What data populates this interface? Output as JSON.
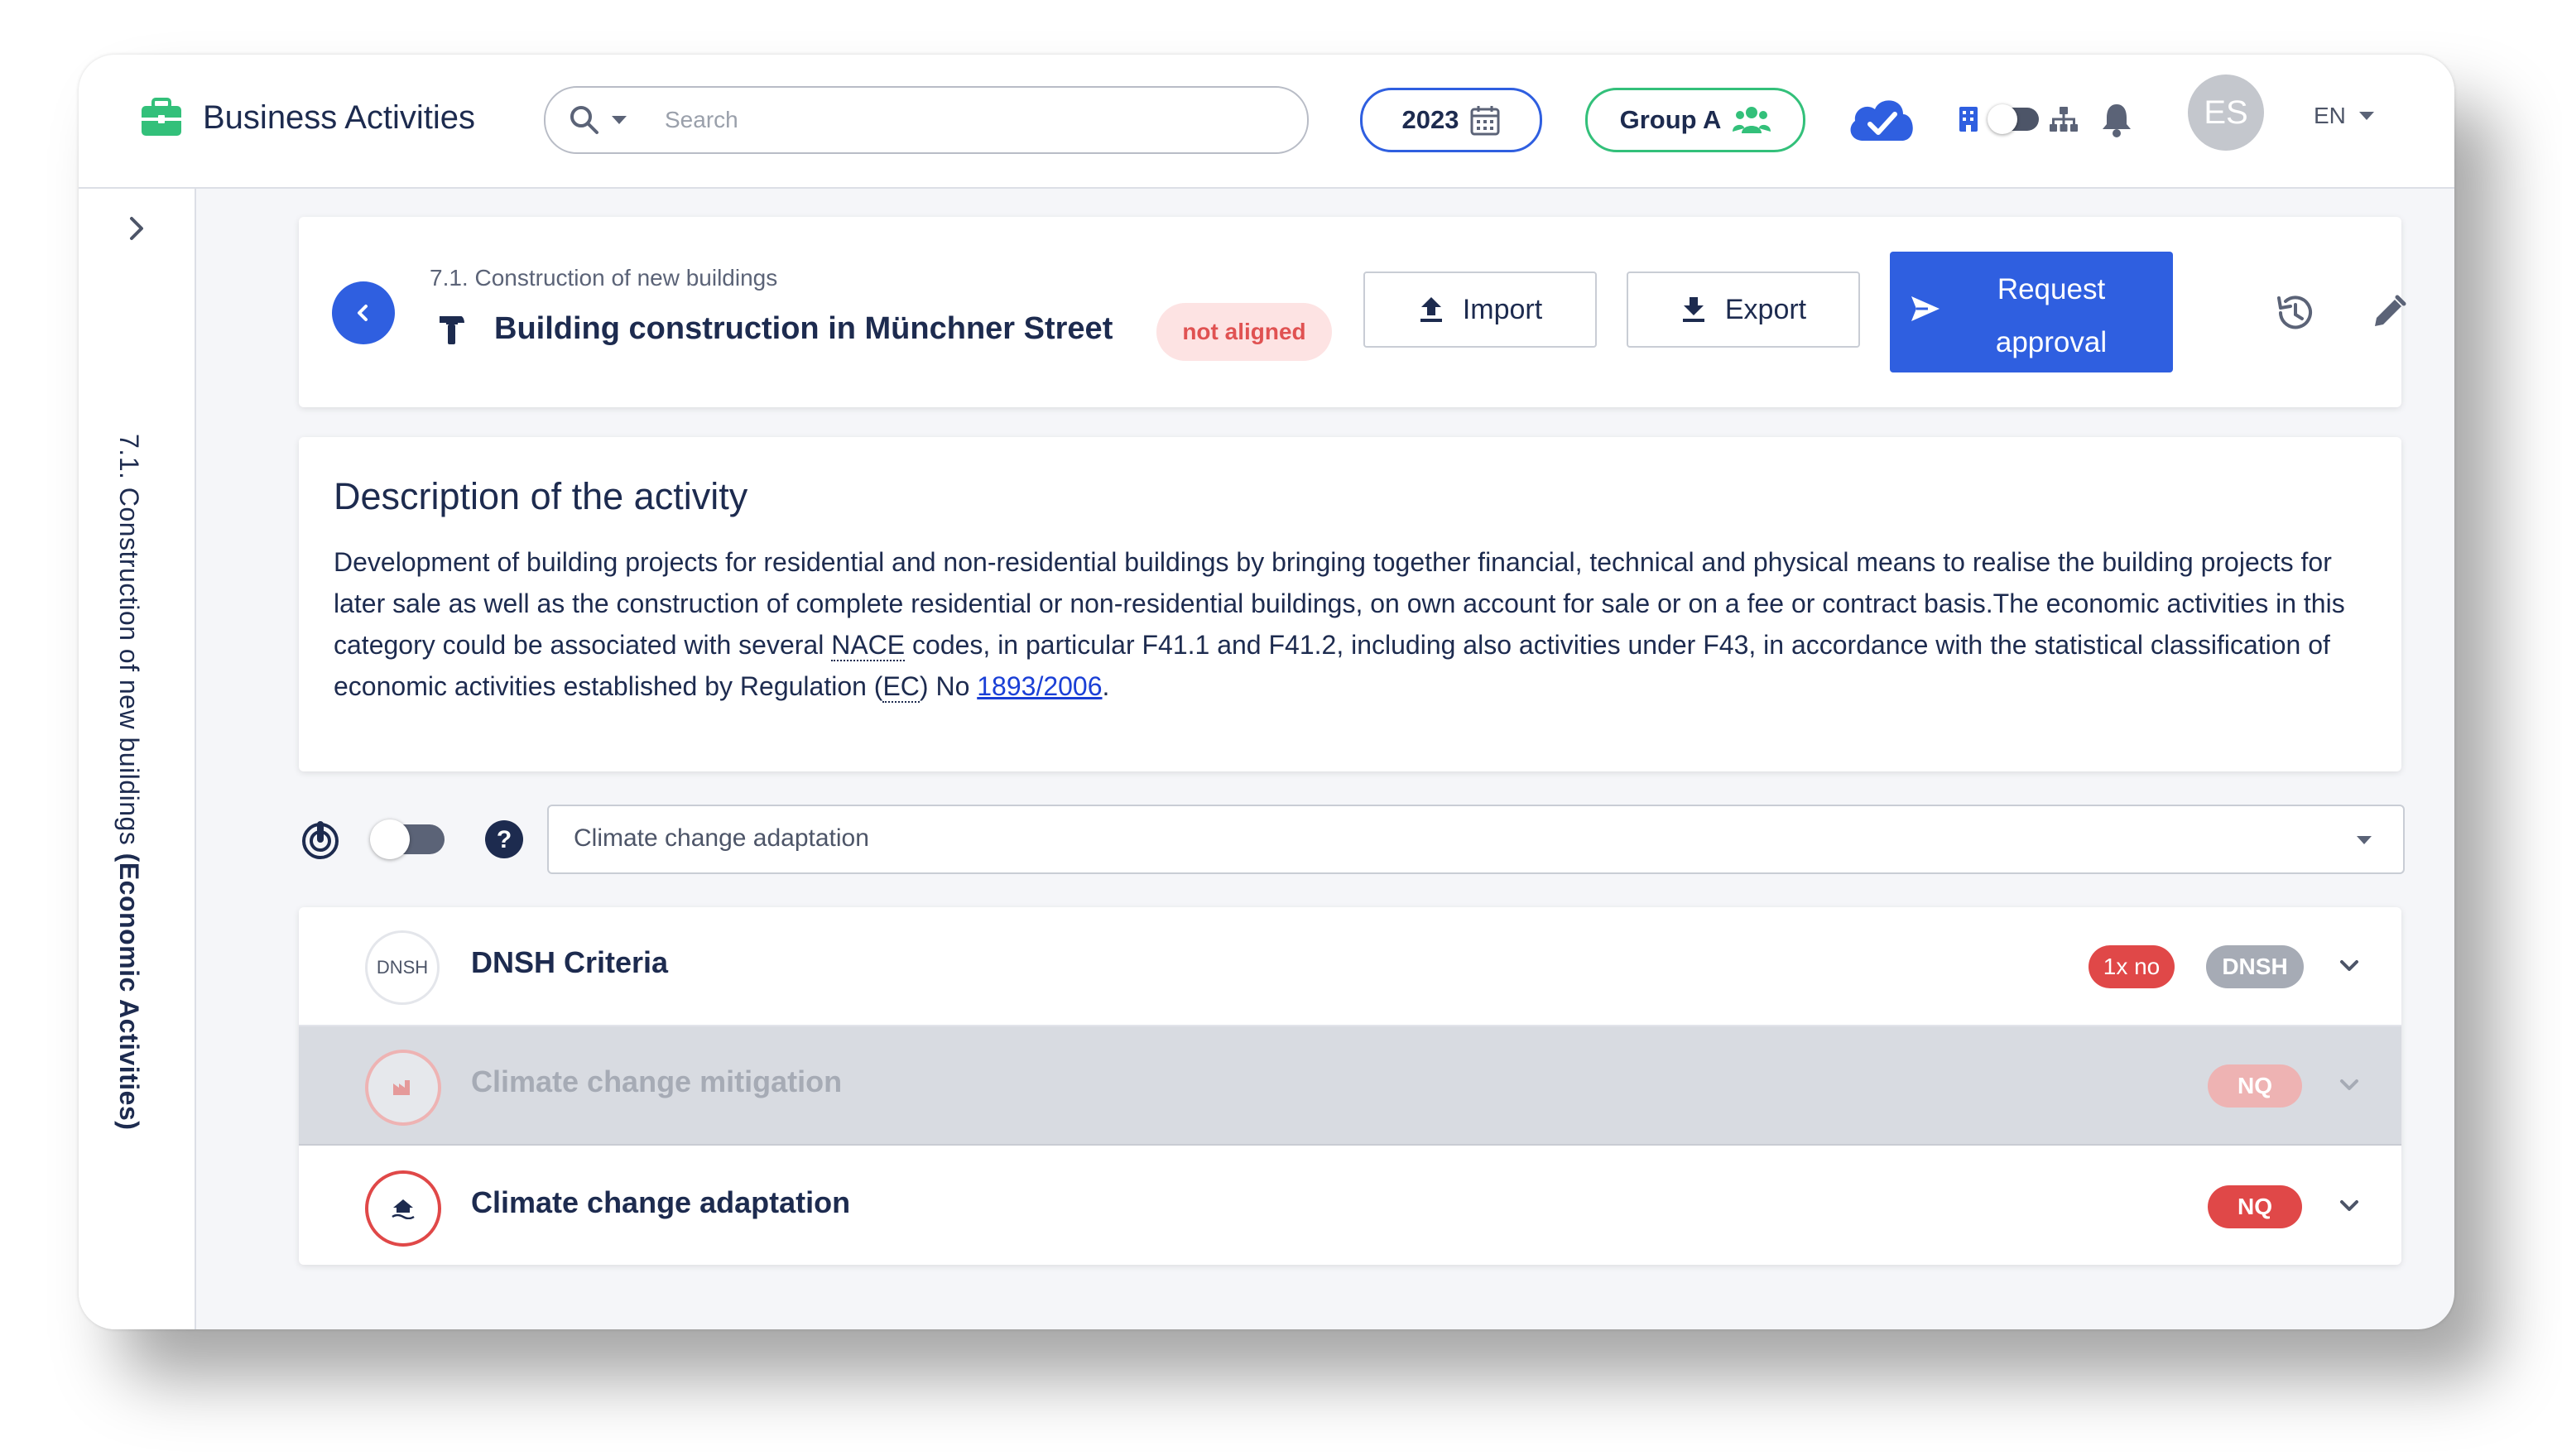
{
  "topbar": {
    "app_title": "Business Activities",
    "search_placeholder": "Search",
    "year": "2023",
    "group": "Group A",
    "avatar_initials": "ES",
    "language": "EN",
    "icons": [
      "briefcase-icon",
      "search-icon",
      "calendar-icon",
      "users-icon",
      "cloud-check-icon",
      "building-icon",
      "hierarchy-icon",
      "bell-icon"
    ]
  },
  "sidebar": {
    "vertical_label_prefix": "7.1. Construction of new buildings ",
    "vertical_label_bold": "(Economic Activities)"
  },
  "activity": {
    "breadcrumb": "7.1. Construction of new buildings",
    "title": "Building construction in Münchner Street",
    "status": "not aligned",
    "import_label": "Import",
    "export_label": "Export",
    "request_label_line1": "Request",
    "request_label_line2": "approval"
  },
  "description": {
    "title": "Description of the activity",
    "text_1": "Development of building projects for residential and non-residential buildings by bringing together financial, technical and physical means to realise the building projects for later sale as well as the construction of complete residential or non-residential buildings, on own account for sale or on a fee or contract basis.The economic activities in this category could be associated with several ",
    "abbr_nace": "NACE",
    "text_2": " codes, in particular F41.1 and F41.2, including also activities under F43, in accordance with the statistical classification of economic activities established by Regulation (",
    "abbr_ec": "EC",
    "text_3": ") No ",
    "link": "1893/2006",
    "text_4": "."
  },
  "filter": {
    "selected": "Climate change adaptation"
  },
  "criteria": [
    {
      "icon_text": "DNSH",
      "label": "DNSH Criteria",
      "badges": [
        "1x no",
        "DNSH"
      ],
      "state": "normal"
    },
    {
      "icon": "factory-icon",
      "label": "Climate change mitigation",
      "badges": [
        "NQ"
      ],
      "state": "disabled"
    },
    {
      "icon": "house-flood-icon",
      "label": "Climate change adaptation",
      "badges": [
        "NQ"
      ],
      "state": "normal"
    }
  ],
  "colors": {
    "primary": "#2f5fe0",
    "brand_green": "#33c07a",
    "danger": "#e04848",
    "text": "#1d2b4f",
    "muted_badge": "#a6abb5"
  }
}
